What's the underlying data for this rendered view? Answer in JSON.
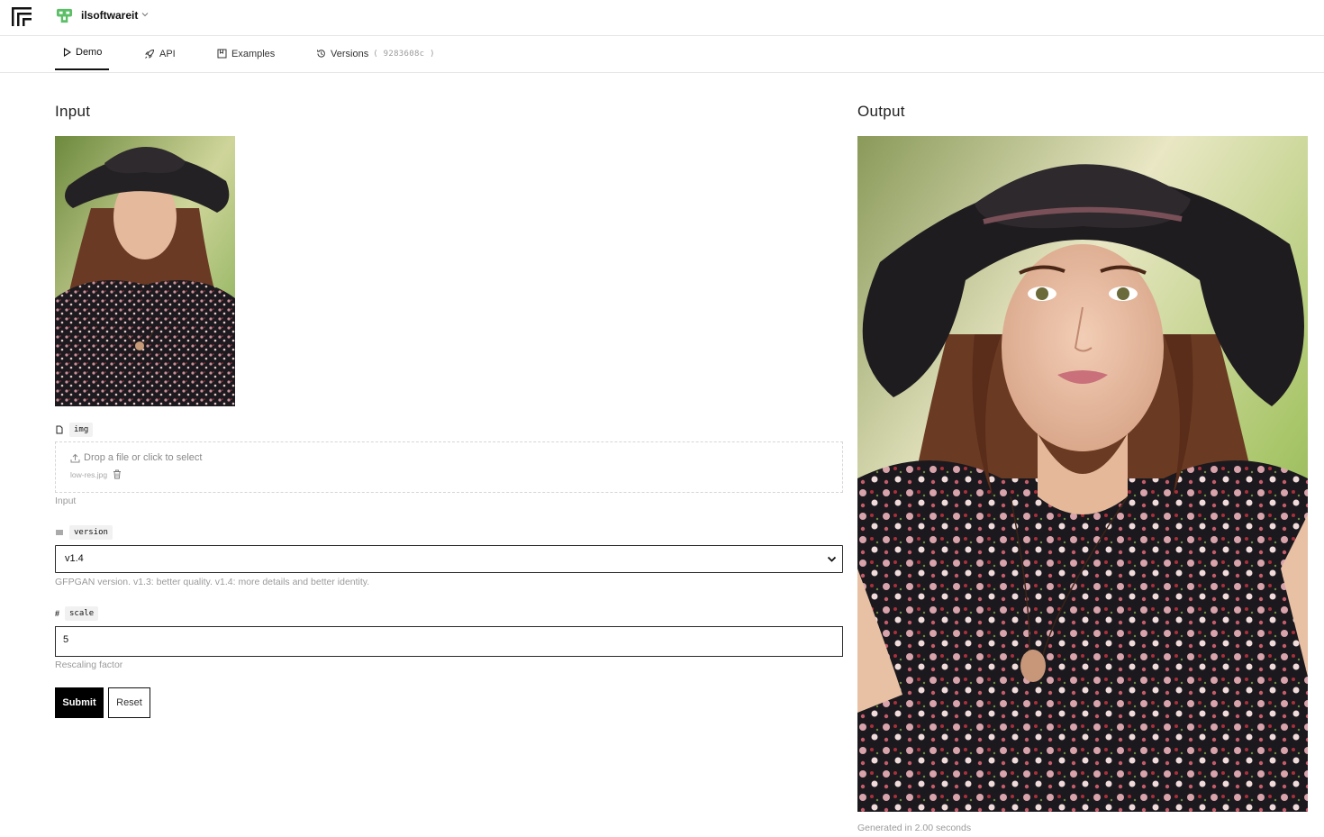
{
  "header": {
    "logo_icon": "replicate-logo-icon",
    "org_name": "ilsoftwareit",
    "org_avatar_color": "#5cbf67",
    "org_chevron_icon": "chevron-down-icon"
  },
  "tabs": [
    {
      "label": "Demo",
      "icon": "play-icon",
      "active": true
    },
    {
      "label": "API",
      "icon": "rocket-icon",
      "active": false
    },
    {
      "label": "Examples",
      "icon": "bookmark-icon",
      "active": false
    },
    {
      "label": "Versions",
      "icon": "history-icon",
      "active": false,
      "version_hash": "( 9283608c )"
    }
  ],
  "input_panel": {
    "title": "Input",
    "img_field": {
      "name": "img",
      "icon": "file-icon",
      "dropzone_text": "Drop a file or click to select",
      "file_name": "low-res.jpg",
      "description": "Input"
    },
    "version_field": {
      "name": "version",
      "icon": "list-icon",
      "selected": "v1.4",
      "description": "GFPGAN version. v1.3: better quality. v1.4: more details and better identity."
    },
    "scale_field": {
      "name": "scale",
      "icon": "hash-icon",
      "value": "5",
      "description": "Rescaling factor"
    },
    "submit_label": "Submit",
    "reset_label": "Reset"
  },
  "output_panel": {
    "title": "Output",
    "generated_text": "Generated in 2.00 seconds"
  },
  "colors": {
    "accent": "#000000",
    "border": "#e6e6e6",
    "muted_text": "#9a9a9a"
  }
}
